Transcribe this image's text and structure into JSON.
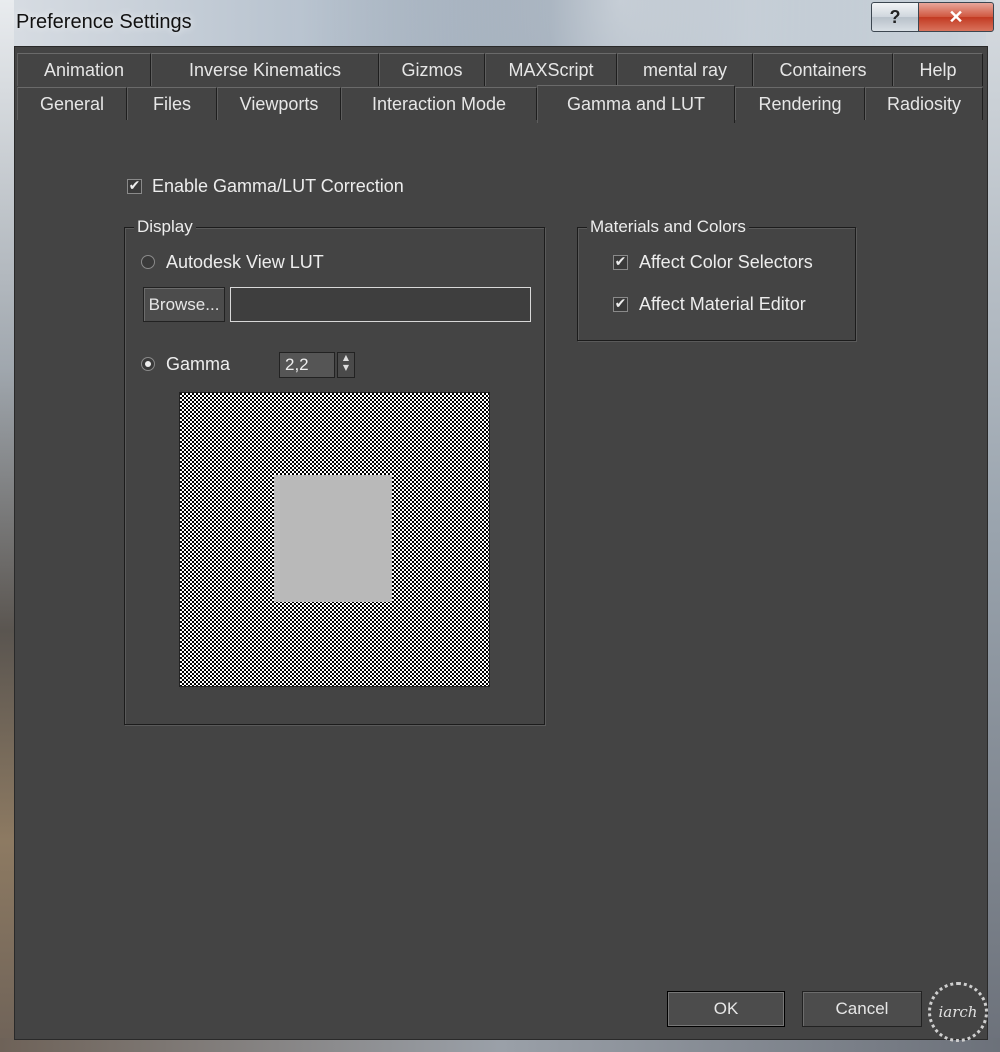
{
  "window": {
    "title": "Preference Settings",
    "help_label": "?",
    "close_label": "✕"
  },
  "tabs": {
    "row1": [
      "Animation",
      "Inverse Kinematics",
      "Gizmos",
      "MAXScript",
      "mental ray",
      "Containers",
      "Help"
    ],
    "row2": [
      "General",
      "Files",
      "Viewports",
      "Interaction Mode",
      "Gamma and LUT",
      "Rendering",
      "Radiosity"
    ],
    "active": "Gamma and LUT"
  },
  "gamma": {
    "enable_label": "Enable Gamma/LUT Correction",
    "enable_checked": true,
    "display": {
      "group_title": "Display",
      "lut_label": "Autodesk View LUT",
      "lut_selected": false,
      "browse_label": "Browse...",
      "lut_path": "",
      "gamma_label": "Gamma",
      "gamma_selected": true,
      "gamma_value": "2,2"
    },
    "materials": {
      "group_title": "Materials and Colors",
      "affect_color_label": "Affect Color Selectors",
      "affect_color_checked": true,
      "affect_material_label": "Affect Material Editor",
      "affect_material_checked": true
    }
  },
  "footer": {
    "ok_label": "OK",
    "cancel_label": "Cancel"
  },
  "watermark": {
    "text": "iarch"
  },
  "icons": {
    "check": "✔",
    "spin_up": "▲",
    "spin_down": "▼"
  }
}
